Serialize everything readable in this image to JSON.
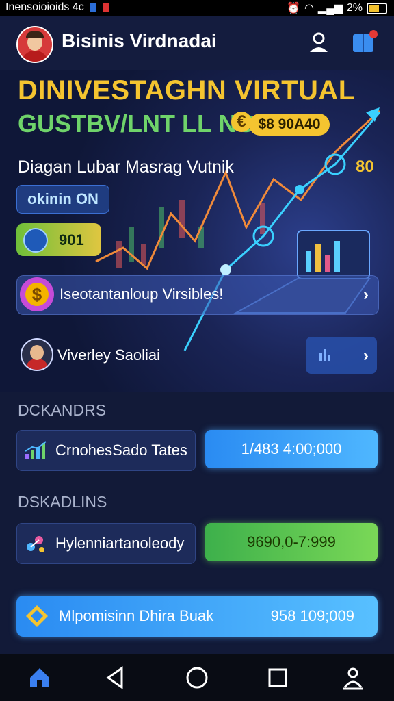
{
  "status_bar": {
    "left_text": "Inensoioioids 4c",
    "battery": "2%"
  },
  "header": {
    "title": "Bisinis Virdnadai"
  },
  "hero": {
    "headline_1": "DINIVESTAGHN VIRTUAL",
    "headline_2": "GUSTBV/LNT LL NG",
    "currency_symbol": "€",
    "price": "$8 90A40",
    "subtitle": "Diagan Lubar Masrag Vutnik",
    "value_right": "80",
    "online_label": "okinin ON",
    "stat_value": "901",
    "row_label": "Iseotantanloup Virsibles!",
    "person_label": "Viverley Saoliai"
  },
  "sections": [
    {
      "heading": "DCKANDRS",
      "card_label": "CrnohesSado Tates",
      "action_value": "1/483 4:00;000",
      "accent": "#2a8bf2"
    },
    {
      "heading": "DSKADLINS",
      "card_label": "Hylenniartanoleody",
      "action_value": "9690,0-7:999",
      "accent": "#3db04b"
    }
  ],
  "bottom_bar": {
    "label": "Mlpomisinn Dhira Buak",
    "value": "958 109;009"
  },
  "icons": [
    "user-icon",
    "book-icon",
    "chart-icon",
    "molecule-icon",
    "home-icon",
    "back-icon",
    "circle-home-icon",
    "recents-icon",
    "account-icon"
  ]
}
